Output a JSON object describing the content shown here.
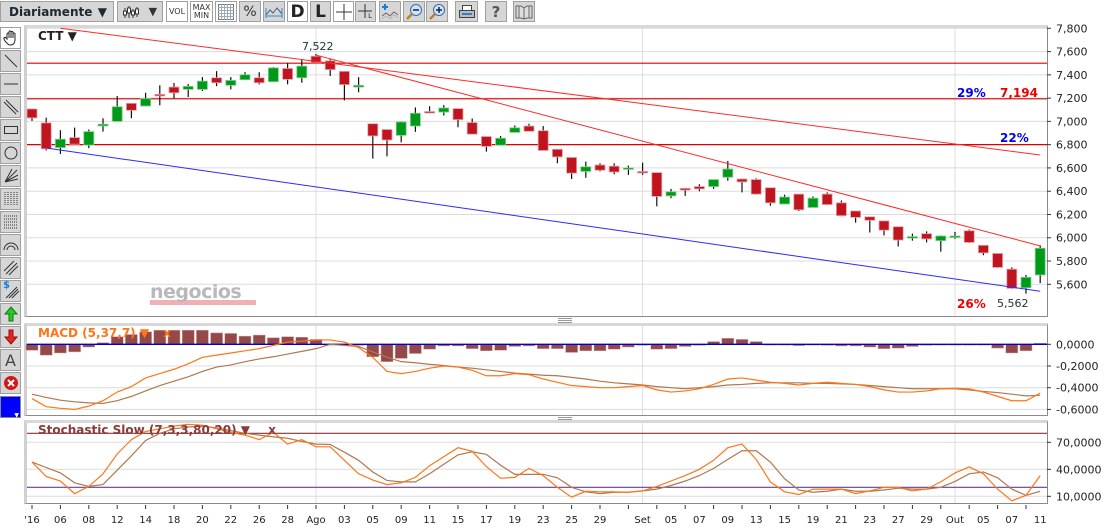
{
  "toolbar": {
    "period": "Diariamente",
    "vol_label": "VOL",
    "max_label": "MAX",
    "min_label": "MIN",
    "percent_label": "%",
    "d_label": "D",
    "l_label": "L",
    "l_small_label": "L",
    "help_label": "?"
  },
  "left_tools": {
    "dollar_label": "$",
    "text_label": "A",
    "color": "#0000ff"
  },
  "main_chart": {
    "symbol": "CTT",
    "watermark": "negocios",
    "high_label": "7,522",
    "pct_29": "29%",
    "level_7194": "7,194",
    "pct_22": "22%",
    "pct_26": "26%",
    "low_label": "5,562"
  },
  "macd": {
    "title": "MACD (5,37,7)",
    "close": "x"
  },
  "stoch": {
    "title": "Stochastic Slow (7,3,3,80,20)",
    "close": "x"
  },
  "colors": {
    "up": "#009a1a",
    "down": "#c0141f",
    "trend_red": "#ff2a2a",
    "level_red": "#dd0000",
    "trend_blue": "#2a2aff",
    "macd_hist": "#944848",
    "macd_zero": "#0000cc",
    "line_orange": "#ff7518",
    "line_brown": "#b07850",
    "stoch_80": "#8b3030",
    "stoch_20": "#6a3d9a"
  },
  "chart_data": [
    {
      "type": "candlestick",
      "title": "CTT",
      "ylim": [
        5325,
        7800
      ],
      "yticks": [
        "7,800",
        "7,600",
        "7,400",
        "7,200",
        "7,000",
        "6,800",
        "6,600",
        "6,400",
        "6,200",
        "6,000",
        "5,800",
        "5,600"
      ],
      "ytick_values": [
        7800,
        7600,
        7400,
        7200,
        7000,
        6800,
        6600,
        6400,
        6200,
        6000,
        5800,
        5600
      ],
      "grid": true,
      "x_labels": [
        {
          "i": 1,
          "label": "'16"
        },
        {
          "i": 3,
          "label": "06"
        },
        {
          "i": 5,
          "label": "08"
        },
        {
          "i": 7,
          "label": "12"
        },
        {
          "i": 9,
          "label": "14"
        },
        {
          "i": 11,
          "label": "18"
        },
        {
          "i": 13,
          "label": "20"
        },
        {
          "i": 15,
          "label": "22"
        },
        {
          "i": 17,
          "label": "26"
        },
        {
          "i": 19,
          "label": "28"
        },
        {
          "i": 21,
          "label": "Ago"
        },
        {
          "i": 23,
          "label": "03"
        },
        {
          "i": 25,
          "label": "05"
        },
        {
          "i": 27,
          "label": "09"
        },
        {
          "i": 29,
          "label": "11"
        },
        {
          "i": 31,
          "label": "15"
        },
        {
          "i": 33,
          "label": "17"
        },
        {
          "i": 35,
          "label": "19"
        },
        {
          "i": 37,
          "label": "23"
        },
        {
          "i": 39,
          "label": "25"
        },
        {
          "i": 41,
          "label": "29"
        },
        {
          "i": 44,
          "label": "Set"
        },
        {
          "i": 46,
          "label": "05"
        },
        {
          "i": 48,
          "label": "07"
        },
        {
          "i": 50,
          "label": "09"
        },
        {
          "i": 52,
          "label": "13"
        },
        {
          "i": 54,
          "label": "15"
        },
        {
          "i": 56,
          "label": "19"
        },
        {
          "i": 58,
          "label": "21"
        },
        {
          "i": 60,
          "label": "23"
        },
        {
          "i": 62,
          "label": "27"
        },
        {
          "i": 64,
          "label": "29"
        },
        {
          "i": 66,
          "label": "Out"
        },
        {
          "i": 68,
          "label": "05"
        },
        {
          "i": 70,
          "label": "07"
        },
        {
          "i": 72,
          "label": "11"
        }
      ],
      "month_gridlines": [
        21,
        44,
        66
      ],
      "ohlc": [
        [
          7107,
          7110,
          7004,
          7030
        ],
        [
          6987,
          7032,
          6750,
          6764
        ],
        [
          6775,
          6924,
          6719,
          6847
        ],
        [
          6861,
          6947,
          6804,
          6804
        ],
        [
          6796,
          6930,
          6770,
          6912
        ],
        [
          6961,
          7027,
          6912,
          6976
        ],
        [
          7000,
          7218,
          7000,
          7126
        ],
        [
          7155,
          7155,
          7027,
          7095
        ],
        [
          7132,
          7246,
          7132,
          7195
        ],
        [
          7232,
          7310,
          7138,
          7224
        ],
        [
          7295,
          7330,
          7198,
          7246
        ],
        [
          7275,
          7321,
          7210,
          7301
        ],
        [
          7275,
          7381,
          7261,
          7346
        ],
        [
          7375,
          7432,
          7303,
          7332
        ],
        [
          7310,
          7381,
          7275,
          7352
        ],
        [
          7358,
          7423,
          7358,
          7401
        ],
        [
          7375,
          7423,
          7318,
          7332
        ],
        [
          7341,
          7466,
          7341,
          7460
        ],
        [
          7455,
          7503,
          7318,
          7361
        ],
        [
          7375,
          7532,
          7332,
          7475
        ],
        [
          7560,
          7580,
          7503,
          7503
        ],
        [
          7520,
          7535,
          7390,
          7445
        ],
        [
          7430,
          7430,
          7180,
          7316
        ],
        [
          7295,
          7380,
          7250,
          7310
        ],
        [
          6980,
          6980,
          6680,
          6875
        ],
        [
          6930,
          6930,
          6700,
          6840
        ],
        [
          6880,
          7000,
          6820,
          6995
        ],
        [
          6960,
          7120,
          6910,
          7070
        ],
        [
          7085,
          7130,
          7070,
          7075
        ],
        [
          7080,
          7140,
          7050,
          7115
        ],
        [
          7110,
          7110,
          6950,
          7015
        ],
        [
          6990,
          7025,
          6890,
          6890
        ],
        [
          6870,
          6870,
          6740,
          6785
        ],
        [
          6795,
          6875,
          6795,
          6855
        ],
        [
          6905,
          6965,
          6905,
          6945
        ],
        [
          6960,
          6980,
          6915,
          6915
        ],
        [
          6920,
          6960,
          6750,
          6750
        ],
        [
          6760,
          6760,
          6640,
          6695
        ],
        [
          6690,
          6690,
          6505,
          6555
        ],
        [
          6570,
          6655,
          6515,
          6610
        ],
        [
          6625,
          6640,
          6570,
          6580
        ],
        [
          6615,
          6640,
          6545,
          6565
        ],
        [
          6595,
          6620,
          6540,
          6600
        ],
        [
          6570,
          6645,
          6540,
          6560
        ],
        [
          6560,
          6560,
          6270,
          6355
        ],
        [
          6360,
          6420,
          6340,
          6395
        ],
        [
          6425,
          6425,
          6360,
          6410
        ],
        [
          6440,
          6460,
          6400,
          6420
        ],
        [
          6440,
          6500,
          6420,
          6500
        ],
        [
          6520,
          6660,
          6490,
          6590
        ],
        [
          6505,
          6505,
          6390,
          6480
        ],
        [
          6500,
          6510,
          6370,
          6375
        ],
        [
          6430,
          6430,
          6275,
          6300
        ],
        [
          6290,
          6370,
          6290,
          6350
        ],
        [
          6375,
          6375,
          6230,
          6240
        ],
        [
          6260,
          6355,
          6260,
          6340
        ],
        [
          6375,
          6390,
          6280,
          6285
        ],
        [
          6300,
          6320,
          6185,
          6190
        ],
        [
          6230,
          6230,
          6130,
          6175
        ],
        [
          6180,
          6180,
          6045,
          6150
        ],
        [
          6145,
          6145,
          6020,
          6065
        ],
        [
          6095,
          6095,
          5925,
          5980
        ],
        [
          6000,
          6035,
          5975,
          6010
        ],
        [
          6035,
          6055,
          5960,
          5990
        ],
        [
          5975,
          6020,
          5880,
          6015
        ],
        [
          6005,
          6050,
          5990,
          6015
        ],
        [
          6060,
          6070,
          5955,
          5960
        ],
        [
          5935,
          5935,
          5850,
          5870
        ],
        [
          5865,
          5865,
          5740,
          5745
        ],
        [
          5730,
          5745,
          5560,
          5565
        ],
        [
          5570,
          5680,
          5520,
          5660
        ],
        [
          5680,
          5935,
          5610,
          5910
        ]
      ],
      "horizontal_levels": [
        7500,
        7194,
        6800
      ],
      "trendlines": [
        {
          "color": "red",
          "from": [
            3,
            7800
          ],
          "to": [
            72,
            6711
          ]
        },
        {
          "color": "red",
          "from": [
            21,
            7570
          ],
          "to": [
            72,
            5930
          ]
        },
        {
          "color": "blue",
          "from": [
            2,
            6771
          ],
          "to": [
            72,
            5540
          ]
        }
      ]
    },
    {
      "type": "bar+line",
      "title": "MACD (5,37,7)",
      "ylim": [
        -0.65,
        0.17
      ],
      "yticks": [
        "0,0000",
        "-0,2000",
        "-0,4000",
        "-0,6000"
      ],
      "ytick_values": [
        0,
        -0.2,
        -0.4,
        -0.6
      ],
      "histogram": [
        -0.055,
        -0.1,
        -0.08,
        -0.07,
        -0.025,
        0.015,
        0.07,
        0.09,
        0.115,
        0.13,
        0.13,
        0.13,
        0.13,
        0.105,
        0.1,
        0.075,
        0.085,
        0.06,
        0.07,
        0.065,
        0.045,
        0,
        0,
        -0.01,
        -0.115,
        -0.16,
        -0.13,
        -0.085,
        -0.045,
        -0.015,
        -0.015,
        -0.04,
        -0.06,
        -0.055,
        -0.02,
        -0.015,
        -0.04,
        -0.04,
        -0.075,
        -0.06,
        -0.06,
        -0.045,
        -0.025,
        -0.01,
        -0.045,
        -0.04,
        -0.02,
        -0.01,
        0.025,
        0.055,
        0.045,
        0.025,
        0,
        0,
        -0.012,
        0,
        -0.01,
        -0.015,
        -0.015,
        -0.025,
        -0.04,
        -0.035,
        -0.02,
        -0.01,
        0,
        0,
        0,
        -0.005,
        -0.035,
        -0.08,
        -0.06,
        0.01
      ],
      "macd": [
        -0.5,
        -0.575,
        -0.59,
        -0.6,
        -0.57,
        -0.52,
        -0.44,
        -0.39,
        -0.31,
        -0.27,
        -0.23,
        -0.18,
        -0.12,
        -0.1,
        -0.08,
        -0.06,
        -0.04,
        -0.01,
        0.02,
        0.03,
        0.04,
        0.04,
        0.02,
        -0.03,
        -0.12,
        -0.25,
        -0.27,
        -0.25,
        -0.22,
        -0.2,
        -0.21,
        -0.24,
        -0.29,
        -0.29,
        -0.27,
        -0.28,
        -0.32,
        -0.35,
        -0.38,
        -0.39,
        -0.4,
        -0.4,
        -0.39,
        -0.38,
        -0.42,
        -0.44,
        -0.43,
        -0.41,
        -0.37,
        -0.32,
        -0.31,
        -0.33,
        -0.35,
        -0.36,
        -0.375,
        -0.36,
        -0.35,
        -0.36,
        -0.37,
        -0.39,
        -0.42,
        -0.44,
        -0.44,
        -0.43,
        -0.41,
        -0.405,
        -0.41,
        -0.44,
        -0.48,
        -0.52,
        -0.52,
        -0.45
      ],
      "signal": [
        -0.46,
        -0.49,
        -0.515,
        -0.53,
        -0.54,
        -0.545,
        -0.52,
        -0.48,
        -0.43,
        -0.38,
        -0.34,
        -0.3,
        -0.25,
        -0.21,
        -0.19,
        -0.16,
        -0.135,
        -0.115,
        -0.09,
        -0.065,
        -0.04,
        0,
        -0.01,
        -0.02,
        -0.07,
        -0.12,
        -0.16,
        -0.17,
        -0.185,
        -0.195,
        -0.21,
        -0.22,
        -0.235,
        -0.25,
        -0.265,
        -0.275,
        -0.285,
        -0.29,
        -0.305,
        -0.32,
        -0.34,
        -0.355,
        -0.365,
        -0.375,
        -0.39,
        -0.4,
        -0.41,
        -0.4,
        -0.39,
        -0.375,
        -0.37,
        -0.36,
        -0.355,
        -0.355,
        -0.355,
        -0.36,
        -0.36,
        -0.365,
        -0.37,
        -0.38,
        -0.39,
        -0.4,
        -0.41,
        -0.41,
        -0.41,
        -0.41,
        -0.42,
        -0.435,
        -0.445,
        -0.46,
        -0.475,
        -0.47
      ]
    },
    {
      "type": "line",
      "title": "Stochastic Slow (7,3,3,80,20)",
      "ylim": [
        1,
        90
      ],
      "yticks": [
        "70,0000",
        "40,0000",
        "10,0000"
      ],
      "ytick_values": [
        70,
        40,
        10
      ],
      "levels": [
        80,
        20
      ],
      "k": [
        48,
        32,
        27,
        13,
        21,
        35,
        57,
        73,
        82,
        85,
        88,
        90,
        89,
        85,
        81,
        78,
        73,
        81,
        68,
        73,
        65,
        65,
        50,
        35,
        28,
        23,
        25,
        31,
        44,
        54,
        64,
        60,
        43,
        30,
        31,
        41,
        33,
        20,
        9,
        15.6,
        15,
        15,
        14.5,
        16,
        21,
        27,
        33,
        40,
        50,
        64,
        68,
        51,
        26,
        15,
        12,
        18,
        18,
        18,
        13,
        16,
        20,
        20,
        16,
        18,
        26,
        36,
        42.6,
        35,
        18,
        5,
        11,
        33
      ],
      "d": [
        48,
        42,
        36,
        25,
        21,
        23,
        39,
        55,
        72,
        80,
        85,
        87,
        88,
        86,
        83,
        80,
        78,
        76,
        74.5,
        71,
        68,
        67.6,
        59,
        50,
        37,
        27.6,
        26,
        26,
        35,
        45.6,
        56,
        59.5,
        56.5,
        44.5,
        34.4,
        34.4,
        34.4,
        30.6,
        20,
        15,
        13,
        14.5,
        14.5,
        16,
        18,
        22,
        27,
        33,
        41,
        51,
        60.6,
        60.6,
        48,
        29.5,
        17,
        14.5,
        15.6,
        18,
        15.6,
        15.6,
        17,
        19,
        18,
        18,
        20,
        26.5,
        35,
        37,
        30.6,
        18,
        11,
        15.6
      ]
    }
  ]
}
